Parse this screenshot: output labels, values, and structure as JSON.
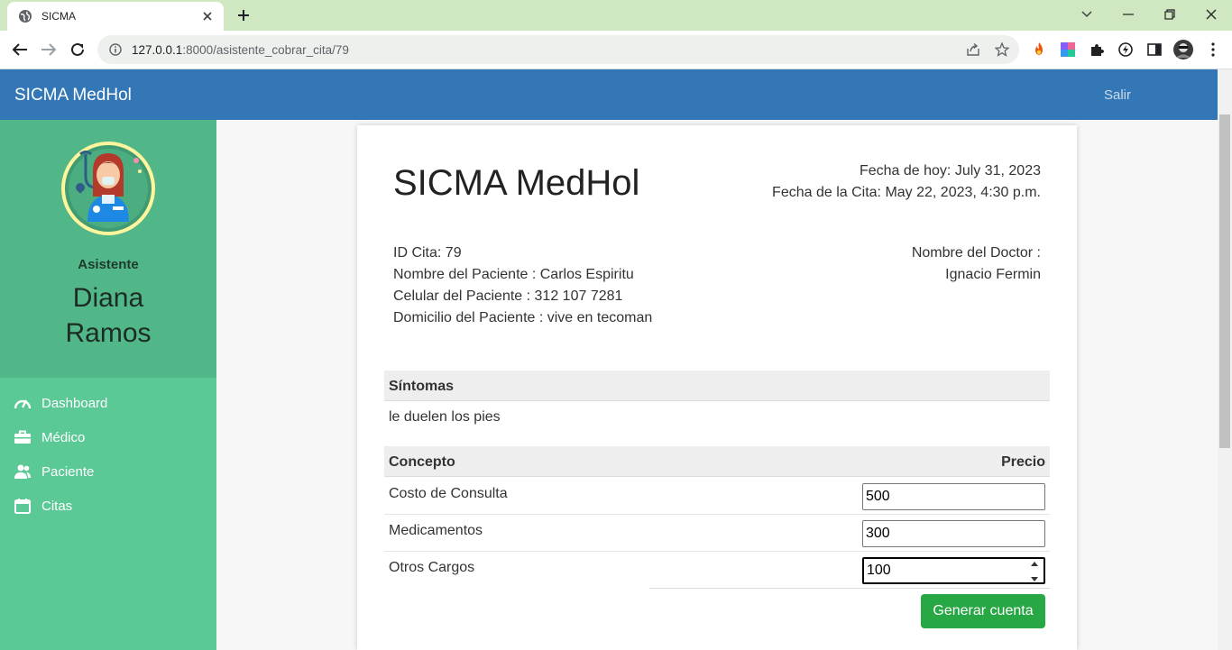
{
  "browser": {
    "tab_title": "SICMA",
    "url_host": "127.0.0.1",
    "url_path": ":8000/asistente_cobrar_cita/79"
  },
  "navbar": {
    "brand": "SICMA MedHol",
    "logout": "Salir"
  },
  "sidebar": {
    "role": "Asistente",
    "user_first": "Diana",
    "user_last": "Ramos",
    "items": [
      {
        "label": "Dashboard",
        "icon": "gauge-icon"
      },
      {
        "label": "Médico",
        "icon": "briefcase-icon"
      },
      {
        "label": "Paciente",
        "icon": "users-icon"
      },
      {
        "label": "Citas",
        "icon": "calendar-icon"
      }
    ]
  },
  "invoice": {
    "title": "SICMA MedHol",
    "today": "Fecha de hoy: July 31, 2023",
    "appointment_date": "Fecha de la Cita: May 22, 2023, 4:30 p.m.",
    "id_cita": "ID Cita: 79",
    "patient_name": "Nombre del Paciente : Carlos Espiritu",
    "patient_phone": "Celular del Paciente : 312 107 7281",
    "patient_address": "Domicilio del Paciente : vive en tecoman",
    "doctor_label": "Nombre del Doctor :",
    "doctor_name": "Ignacio Fermin",
    "symptoms_header": "Síntomas",
    "symptoms_text": "le duelen los pies",
    "concept_header": "Concepto",
    "price_header": "Precio",
    "rows": [
      {
        "label": "Costo de Consulta",
        "value": "500"
      },
      {
        "label": "Medicamentos",
        "value": "300"
      },
      {
        "label": "Otros Cargos",
        "value": "100"
      }
    ],
    "button": "Generar cuenta"
  },
  "colors": {
    "navbar": "#3477b7",
    "sidebar": "#5bc995",
    "sidebar_profile": "#52b788",
    "button": "#28a745"
  }
}
